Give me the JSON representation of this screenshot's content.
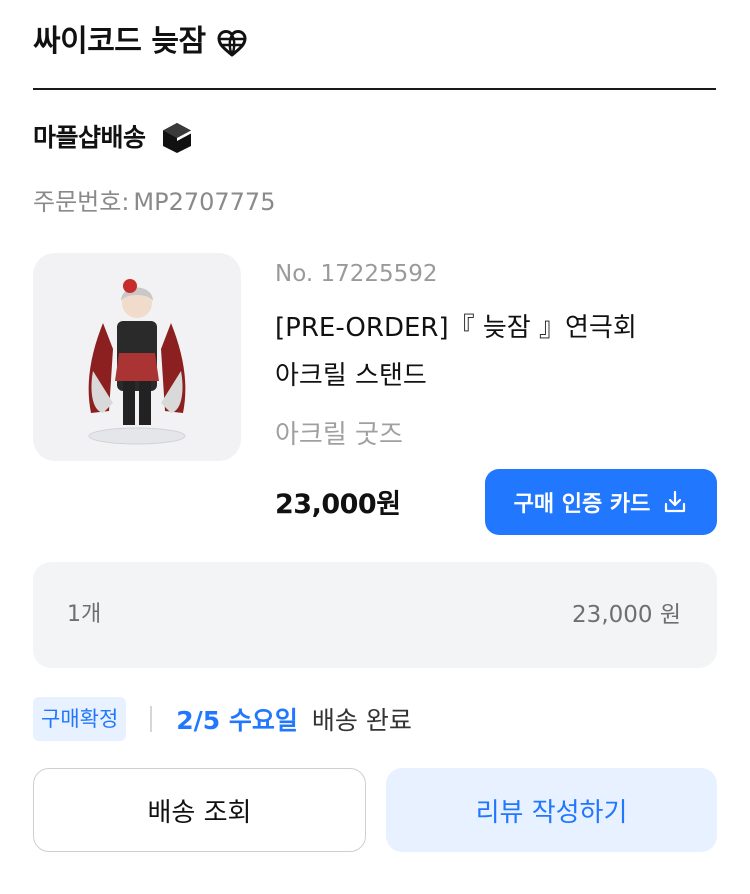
{
  "header": {
    "shop_name": "싸이코드 늦잠",
    "icon": "heart-globe-icon"
  },
  "shipping": {
    "title": "마플샵배송",
    "icon": "box-icon"
  },
  "order": {
    "label": "주문번호:",
    "number": "MP2707775"
  },
  "product": {
    "number": "No. 17225592",
    "title_line1": "[PRE-ORDER]『 늦잠 』연극회",
    "title_line2": "아크릴 스탠드",
    "category": "아크릴 굿즈",
    "price": "23,000원",
    "card_button": "구매 인증 카드"
  },
  "summary": {
    "quantity": "1개",
    "total": "23,000 원"
  },
  "status": {
    "badge": "구매확정",
    "date": "2/5 수요일",
    "text": "배송 완료"
  },
  "actions": {
    "track": "배송 조회",
    "review": "리뷰 작성하기"
  },
  "colors": {
    "accent": "#2277ff",
    "accent_bg": "#e8f1ff",
    "panel": "#f3f4f6"
  }
}
